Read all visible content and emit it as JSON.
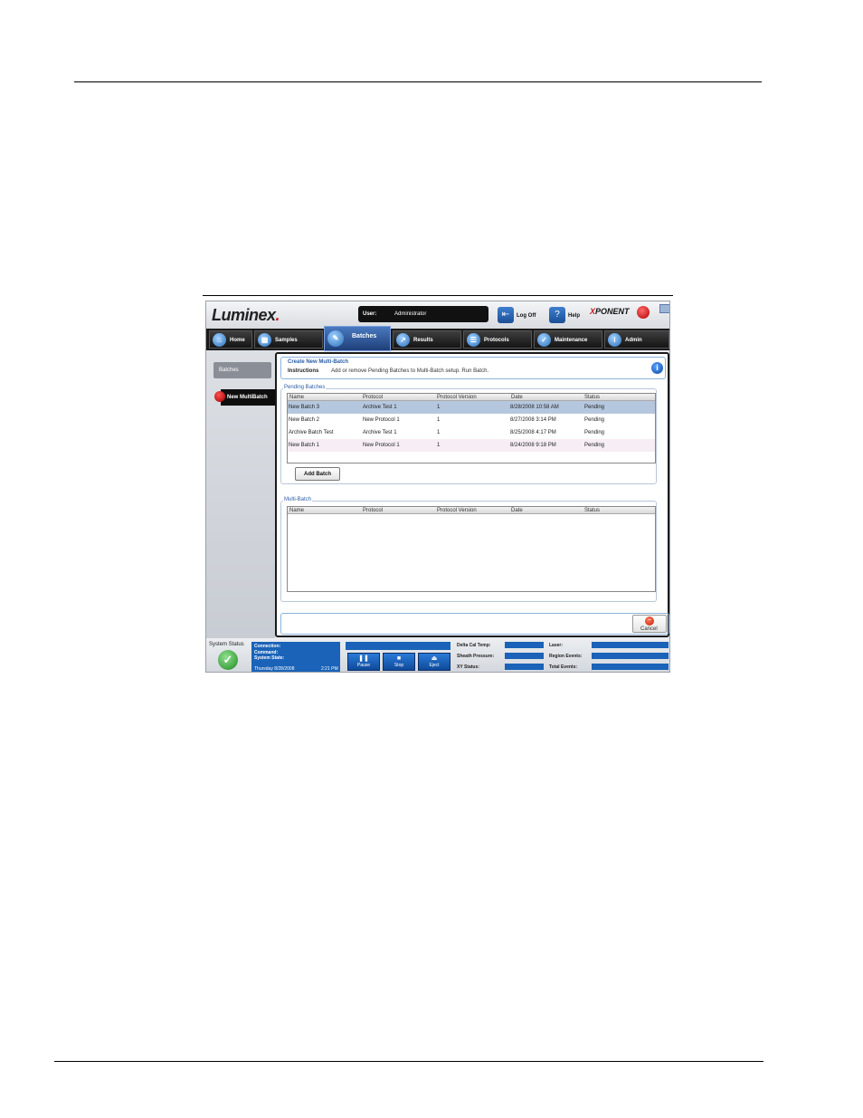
{
  "app": {
    "logo": "Luminex",
    "user_label": "User:",
    "user_value": "Administrator",
    "log_off": "Log Off",
    "help": "Help",
    "brand_x": "X",
    "brand_rest": "PONENT"
  },
  "nav": {
    "tabs": [
      {
        "label": "Home",
        "icon": "home-icon"
      },
      {
        "label": "Samples",
        "icon": "samples-icon"
      },
      {
        "label": "Batches",
        "icon": "batches-icon",
        "active": true
      },
      {
        "label": "Results",
        "icon": "results-icon"
      },
      {
        "label": "Protocols",
        "icon": "protocols-icon"
      },
      {
        "label": "Maintenance",
        "icon": "maintenance-icon"
      },
      {
        "label": "Admin",
        "icon": "admin-icon"
      }
    ]
  },
  "sidebar": {
    "items": [
      {
        "label": "Batches"
      },
      {
        "label": "New MultiBatch",
        "active": true
      }
    ]
  },
  "instructions": {
    "title": "Create New Multi-Batch",
    "label": "Instructions",
    "text": "Add or remove Pending Batches to Multi-Batch setup. Run Batch."
  },
  "pending": {
    "title": "Pending Batches",
    "columns": [
      "Name",
      "Protocol",
      "Protocol Version",
      "Date",
      "Status"
    ],
    "rows": [
      [
        "New Batch 3",
        "Archive Test 1",
        "1",
        "8/28/2008 10:58 AM",
        "Pending"
      ],
      [
        "New Batch 2",
        "New Protocol 1",
        "1",
        "8/27/2008 3:14 PM",
        "Pending"
      ],
      [
        "Archive Batch Test",
        "Archive Test 1",
        "1",
        "8/25/2008 4:17 PM",
        "Pending"
      ],
      [
        "New Batch 1",
        "New Protocol 1",
        "1",
        "8/24/2008 9:18 PM",
        "Pending"
      ]
    ],
    "add_button": "Add Batch"
  },
  "multibatch": {
    "title": "Multi-Batch",
    "columns": [
      "Name",
      "Protocol",
      "Protocol Version",
      "Date",
      "Status"
    ]
  },
  "footer": {
    "cancel": "Cancel"
  },
  "status": {
    "system_status": "System Status",
    "connection": "Connection:",
    "command": "Command:",
    "system_state": "System State:",
    "day": "Thursday 8/28/2008",
    "time": "2:21 PM",
    "pause": "Pause",
    "stop": "Stop",
    "eject": "Eject",
    "delta_cal_temp": "Delta Cal Temp:",
    "sheath_pressure": "Sheath Pressure:",
    "xy_status": "XY Status:",
    "laser": "Laser:",
    "region_events": "Region Events:",
    "total_events": "Total Events:"
  },
  "colors": {
    "accent": "#2b5da6",
    "status_blue": "#1a63b8",
    "selected_row": "#b5c7de"
  }
}
